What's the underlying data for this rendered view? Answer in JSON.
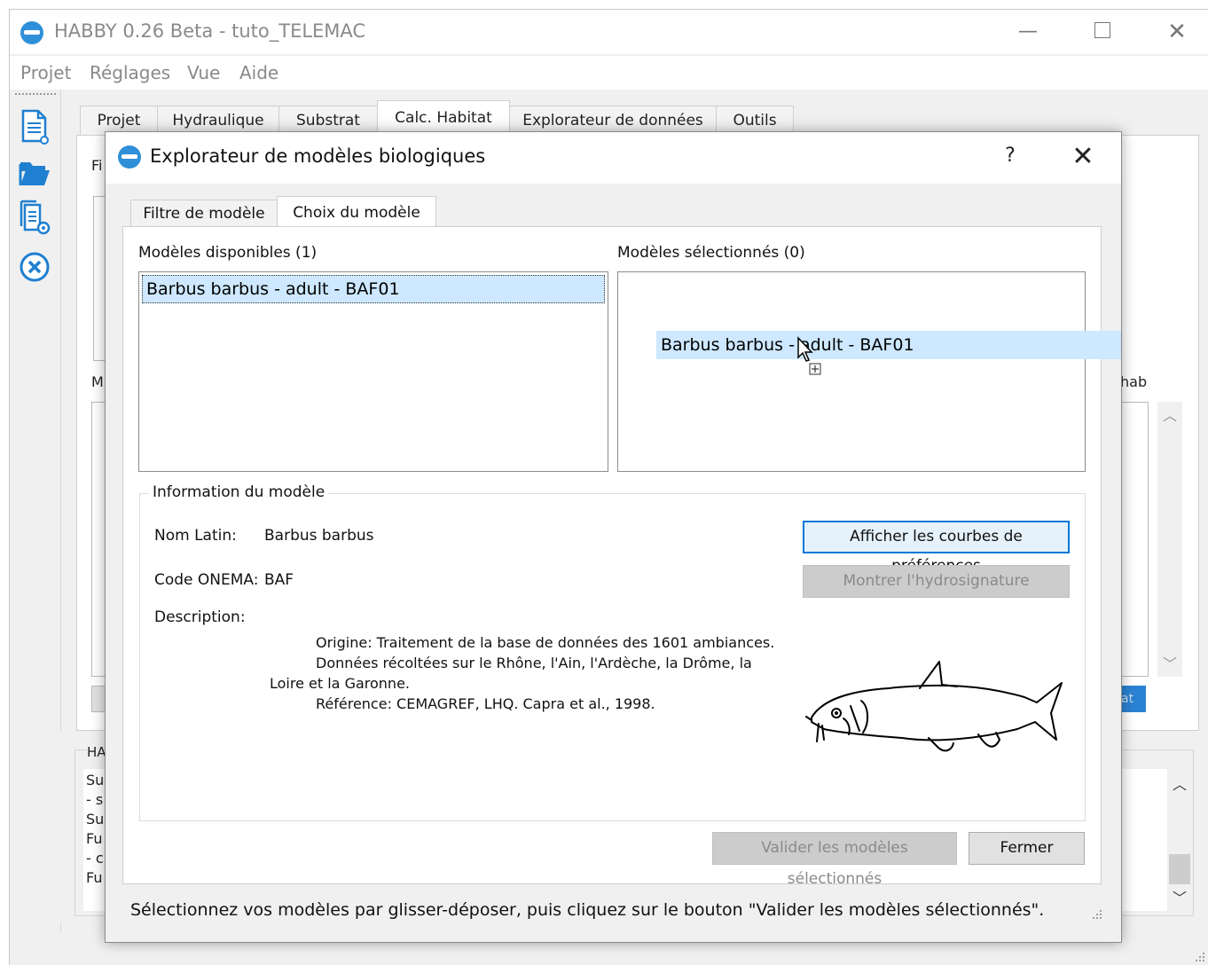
{
  "window": {
    "title": "HABBY 0.26 Beta - tuto_TELEMAC",
    "minimize_glyph": "—",
    "close_glyph": "✕"
  },
  "menu": [
    "Projet",
    "Réglages",
    "Vue",
    "Aide"
  ],
  "toolbar_icons": [
    "new-document-icon",
    "open-folder-icon",
    "document-preview-icon",
    "close-circle-icon"
  ],
  "main_tabs": [
    "Projet",
    "Hydraulique",
    "Substrat",
    "Calc. Habitat",
    "Explorateur de données",
    "Outils"
  ],
  "main_active_tab": "Calc. Habitat",
  "background_fragments": {
    "label_f": "Fi",
    "label_m": "M",
    "label_hab": "hab",
    "log_title": "HA",
    "log_lines": [
      "Su",
      "- s",
      "Su",
      "Fu",
      "- c",
      "Fu"
    ],
    "button_fragment": "at"
  },
  "dialog": {
    "title": "Explorateur de modèles biologiques",
    "help_glyph": "?",
    "close_glyph": "✕",
    "tabs": [
      "Filtre de modèle",
      "Choix du modèle"
    ],
    "active_tab": "Choix du modèle",
    "available_label": "Modèles disponibles (1)",
    "available_items": [
      "Barbus barbus - adult - BAF01"
    ],
    "selected_label": "Modèles sélectionnés (0)",
    "drag_item": "Barbus barbus - adult - BAF01",
    "info": {
      "group_title": "Information du modèle",
      "latin_label": "Nom Latin:",
      "latin_value": "Barbus barbus",
      "code_label": "Code ONEMA:",
      "code_value": "BAF",
      "desc_label": "Description:",
      "desc_lines": [
        "Origine: Traitement de la base de données des 1601 ambiances.",
        "Données récoltées sur le Rhône, l'Ain, l'Ardèche, la Drôme, la",
        "Loire et la Garonne.",
        "Référence: CEMAGREF, LHQ. Capra et al., 1998."
      ],
      "show_curves_button": "Afficher les courbes de préférences",
      "hydrosignature_button": "Montrer l'hydrosignature"
    },
    "validate_button": "Valider les modèles sélectionnés",
    "close_button": "Fermer",
    "status": "Sélectionnez vos modèles par glisser-déposer, puis cliquez sur le bouton \"Valider les modèles sélectionnés\"."
  }
}
